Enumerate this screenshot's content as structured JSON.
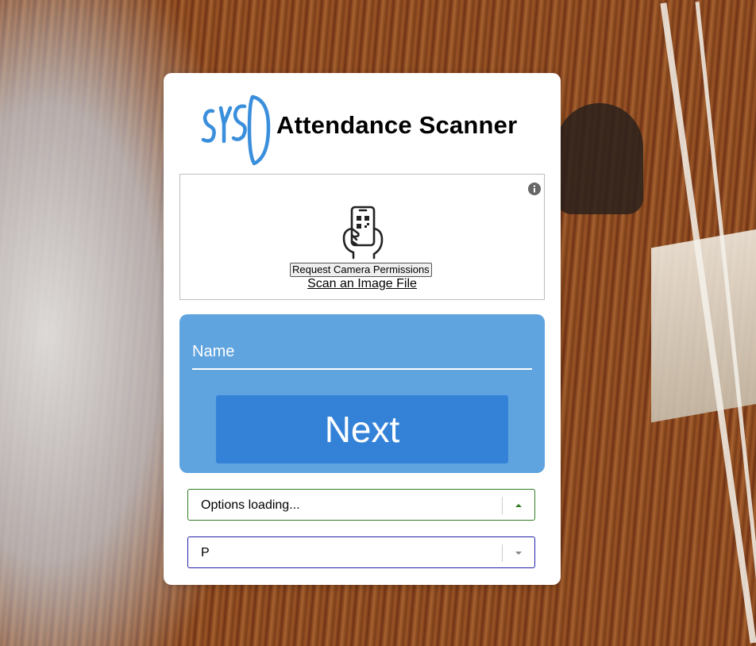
{
  "header": {
    "logo_text": "SYSO",
    "title": "Attendance Scanner"
  },
  "scanner": {
    "info_icon": "info-icon",
    "phone_icon": "qr-phone-icon",
    "permission_button": "Request Camera Permissions",
    "scan_file_link": "Scan an Image File"
  },
  "form": {
    "name_placeholder": "Name",
    "next_button": "Next"
  },
  "selects": {
    "options_value": "Options loading...",
    "options_icon": "chevron-up-icon",
    "second_value": "P",
    "second_icon": "chevron-down-icon"
  },
  "colors": {
    "panel_blue": "#5fa3df",
    "button_blue": "#3482d8",
    "logo_blue": "#3a8fdc"
  }
}
